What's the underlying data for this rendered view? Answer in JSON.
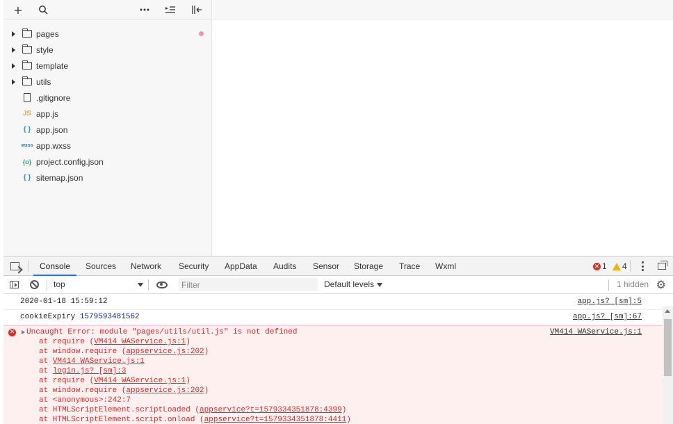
{
  "sidebar": {
    "toolbar": {
      "add": "+",
      "search": "⌕",
      "more": "···",
      "outline": "⇤",
      "collapse": "⇤"
    },
    "tree": [
      {
        "label": "pages",
        "type": "folder",
        "modified": true
      },
      {
        "label": "style",
        "type": "folder"
      },
      {
        "label": "template",
        "type": "folder"
      },
      {
        "label": "utils",
        "type": "folder"
      },
      {
        "label": ".gitignore",
        "type": "file",
        "icon": "file-icon"
      },
      {
        "label": "app.js",
        "type": "file",
        "icon": "js-icon",
        "badge": "JS"
      },
      {
        "label": "app.json",
        "type": "file",
        "icon": "json-icon",
        "badge": "{ }"
      },
      {
        "label": "app.wxss",
        "type": "file",
        "icon": "wxss-icon",
        "badge": "wxss"
      },
      {
        "label": "project.config.json",
        "type": "file",
        "icon": "config-icon",
        "badge": "{o}"
      },
      {
        "label": "sitemap.json",
        "type": "file",
        "icon": "json-icon",
        "badge": "{ }"
      }
    ]
  },
  "devtools": {
    "tabs": [
      "Console",
      "Sources",
      "Network",
      "Security",
      "AppData",
      "Audits",
      "Sensor",
      "Storage",
      "Trace",
      "Wxml"
    ],
    "active_tab": "Console",
    "error_count": "1",
    "warning_count": "4",
    "filterbar": {
      "context": "top",
      "filter_placeholder": "Filter",
      "levels": "Default levels",
      "hidden": "1 hidden"
    },
    "messages": [
      {
        "text": "2020-01-18 15:59:12",
        "source": "app.js? [sm]:5"
      },
      {
        "text_key": "cookieExpiry",
        "text_value": "1579593481562",
        "source": "app.js? [sm]:67"
      }
    ],
    "error": {
      "message": "Uncaught Error: module \"pages/utils/util.js\" is not defined",
      "source": "VM414 WAService.js:1",
      "stack": [
        {
          "pre": "at require (",
          "link": "VM414 WAService.js:1",
          "post": ")"
        },
        {
          "pre": "at window.require (",
          "link": "appservice.js:202",
          "post": ")"
        },
        {
          "pre": "at ",
          "link": "VM414 WAService.js:1",
          "post": ""
        },
        {
          "pre": "at ",
          "link": "login.js? [sm]:3",
          "post": ""
        },
        {
          "pre": "at require (",
          "link": "VM414 WAService.js:1",
          "post": ")"
        },
        {
          "pre": "at window.require (",
          "link": "appservice.js:202",
          "post": ")"
        },
        {
          "pre": "at <anonymous>:242:7",
          "link": "",
          "post": ""
        },
        {
          "pre": "at HTMLScriptElement.scriptLoaded (",
          "link": "appservice?t=1579334351878:4399",
          "post": ")"
        },
        {
          "pre": "at HTMLScriptElement.script.onload (",
          "link": "appservice?t=1579334351878:4411",
          "post": ")"
        }
      ]
    }
  },
  "colors": {
    "error": "#e02828",
    "modified_dot": "#f48fb1",
    "js_icon": "#e8a33d",
    "json_icon": "#1e9bd7",
    "wxss_icon": "#2d7ab8",
    "config_icon": "#2aa876",
    "active_tab": "#1a73e8"
  }
}
